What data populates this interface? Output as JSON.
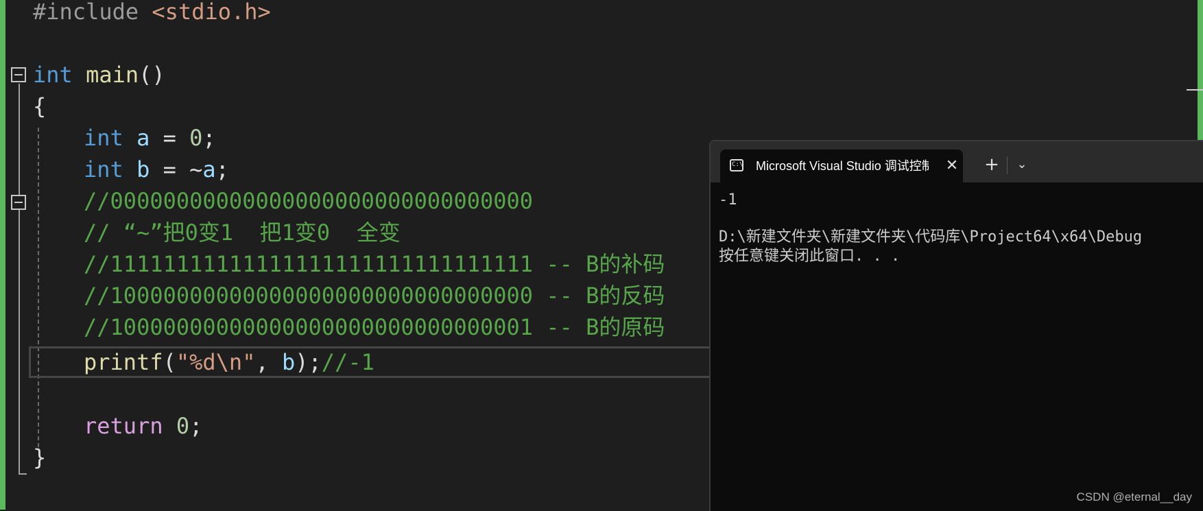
{
  "editor": {
    "lines": {
      "l1_pre": "#include",
      "l1_hdr": "<stdio.h>",
      "l2_kw": "int",
      "l2_fn": "main",
      "l2_paren": "()",
      "l3_brace": "{",
      "l4_kw": "int",
      "l4_var": "a",
      "l4_op": " = ",
      "l4_num": "0",
      "l4_end": ";",
      "l5_kw": "int",
      "l5_var": "b",
      "l5_op": " = ~",
      "l5_var2": "a",
      "l5_end": ";",
      "c1": "//00000000000000000000000000000000",
      "c2": "// “~”把0变1  把1变0  全变",
      "c3": "//11111111111111111111111111111111 -- B的补码",
      "c4": "//10000000000000000000000000000000 -- B的反码",
      "c5": "//10000000000000000000000000000001 -- B的原码",
      "p_fn": "printf",
      "p_open": "(",
      "p_str": "\"%d\\n\"",
      "p_comma": ", ",
      "p_var": "b",
      "p_close": ");",
      "p_cmt": "//-1",
      "r_kw": "return",
      "r_num": "0",
      "r_end": ";",
      "close_brace": "}"
    }
  },
  "terminal": {
    "tab_title": "Microsoft Visual Studio 调试控制台",
    "tab_close": "✕",
    "tab_new": "+",
    "tab_dropdown": "⌄",
    "output_line1": "-1",
    "output_line2": "D:\\新建文件夹\\新建文件夹\\代码库\\Project64\\x64\\Debug",
    "output_line3": "按任意键关闭此窗口. . ."
  },
  "watermark": "CSDN @eternal__day",
  "colors": {
    "editor_bg": "#1e1e1e",
    "keyword": "#569cd6",
    "function": "#dcdcaa",
    "comment": "#57a64a",
    "terminal_bg": "#0c0c0c",
    "change_bar": "#5cb85c"
  }
}
